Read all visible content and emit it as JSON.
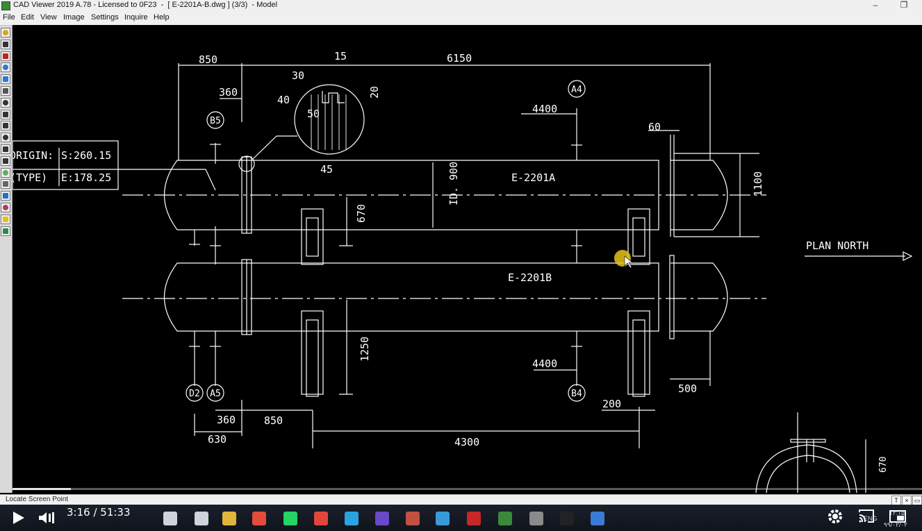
{
  "window": {
    "title": "CAD Viewer 2019 A.78 - Licensed to 0F23  -  [ E-2201A-B.dwg ] (3/3)  - Model",
    "minimize_glyph": "–",
    "restore_glyph": "❐"
  },
  "menu": [
    "File",
    "Edit",
    "View",
    "Image",
    "Settings",
    "Inquire",
    "Help"
  ],
  "left_toolbar": {
    "icons": [
      "open-file-icon",
      "save-icon",
      "pdf-icon",
      "forward-icon",
      "back-icon",
      "print-icon",
      "hand-pan-icon",
      "zoom-icon",
      "zoom-in-icon",
      "zoom-out-icon",
      "zoom-window-icon",
      "zoom-previous-icon",
      "redraw-icon",
      "measure-icon",
      "info-icon",
      "layers-icon",
      "help-icon",
      "settings-grid-icon"
    ]
  },
  "drawing": {
    "dimensions": {
      "d850_top": "850",
      "d15": "15",
      "d6150": "6150",
      "d30": "30",
      "d360_top": "360",
      "d40": "40",
      "d20": "20",
      "d50": "50",
      "d45": "45",
      "d4400_top": "4400",
      "d60": "60",
      "d670": "670",
      "d900": "ID. 900",
      "d1100": "1100",
      "d1250": "1250",
      "d4400_bottom": "4400",
      "d200": "200",
      "d500": "500",
      "d360_bottom": "360",
      "d850_bottom": "850",
      "d630": "630",
      "d4300": "4300",
      "d670_small": "670"
    },
    "nozzles": {
      "b5": "B5",
      "a4": "A4",
      "d2": "D2",
      "a5": "A5",
      "b4": "B4"
    },
    "labels": {
      "vessel_a": "E-2201A",
      "vessel_b": "E-2201B",
      "plan_north": "PLAN NORTH",
      "origin_label": "ORIGIN:",
      "origin_value": "S:260.15",
      "type_label": "(TYPE)",
      "type_value": "E:178.25"
    }
  },
  "status": {
    "text": "Locate Screen Point",
    "mini_buttons": [
      "T",
      "×",
      "▭"
    ]
  },
  "player": {
    "time_current": "3:16",
    "time_separator": " / ",
    "time_total": "51:33",
    "progress_fraction": 0.064
  },
  "taskbar": {
    "icons": [
      "windows-start-icon",
      "search-icon",
      "task-view-icon",
      "file-explorer-icon",
      "chrome-icon",
      "whatsapp-icon",
      "anydesk-icon",
      "telegram-icon",
      "media-player-icon",
      "photos-icon",
      "edge-icon",
      "vpn-icon",
      "cad-viewer-icon",
      "calculator-icon",
      "terminal-icon",
      "autocad-icon"
    ],
    "tray": {
      "lang": "ENG",
      "time": "۱۲:۱۵",
      "date": "۹۹/۰۲/۰۲"
    },
    "accent_color": "#ffd400"
  }
}
